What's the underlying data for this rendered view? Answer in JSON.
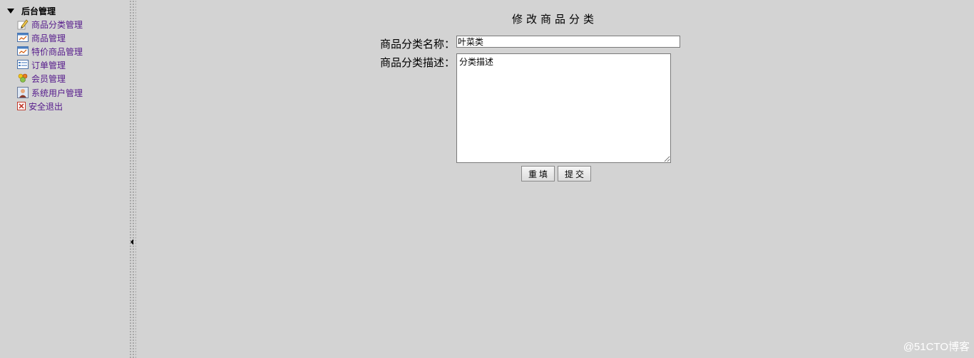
{
  "sidebar": {
    "root_label": "后台管理",
    "items": [
      {
        "label": "商品分类管理",
        "icon": "edit-pencil-icon"
      },
      {
        "label": "商品管理",
        "icon": "window-chart-icon"
      },
      {
        "label": "特价商品管理",
        "icon": "window-chart-icon"
      },
      {
        "label": "订单管理",
        "icon": "list-form-icon"
      },
      {
        "label": "会员管理",
        "icon": "users-group-icon"
      },
      {
        "label": "系统用户管理",
        "icon": "user-portrait-icon"
      },
      {
        "label": "安全退出",
        "icon": "close-x-icon"
      }
    ]
  },
  "form": {
    "title": "修改商品分类",
    "name_label": "商品分类名称：",
    "name_value": "叶菜类",
    "desc_label": "商品分类描述：",
    "desc_value": "分类描述",
    "reset_label": "重填",
    "submit_label": "提交"
  },
  "watermark": "@51CTO博客",
  "colors": {
    "background": "#d3d3d3",
    "link": "#551a8b"
  }
}
